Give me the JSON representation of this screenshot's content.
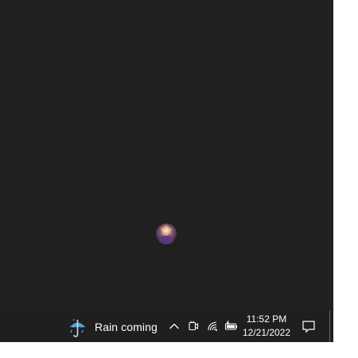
{
  "desktop": {
    "background_color": "#202020"
  },
  "taskbar": {
    "weather": {
      "icon": "umbrella-rain-icon",
      "text": "Rain coming"
    },
    "tray": {
      "overflow_icon": "chevron-up-icon",
      "meet_icon": "camera-icon",
      "network_icon": "wifi-icon",
      "battery_icon": "battery-charging-icon"
    },
    "clock": {
      "time": "11:52 PM",
      "date": "12/21/2022"
    },
    "notifications_icon": "notification-center-icon"
  }
}
